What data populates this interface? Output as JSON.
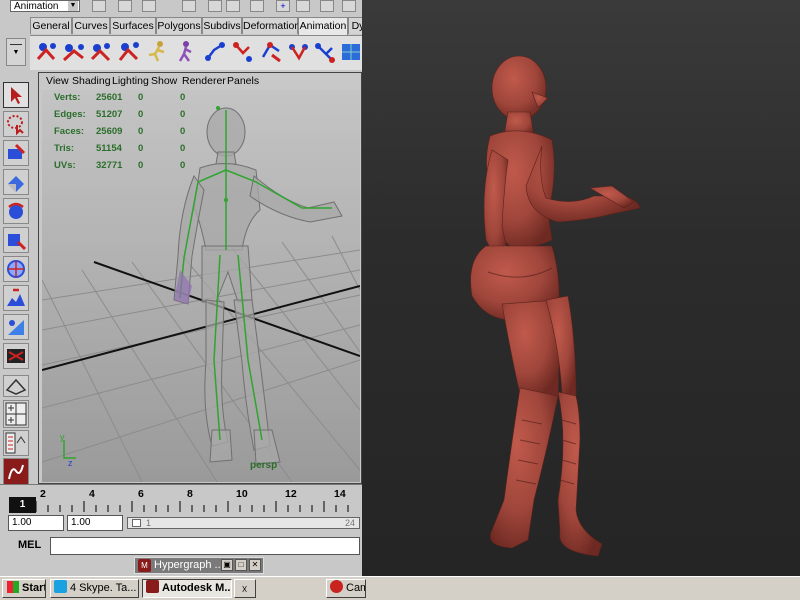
{
  "maya": {
    "mode_select": "Animation",
    "shelf_tabs": [
      "General",
      "Curves",
      "Surfaces",
      "Polygons",
      "Subdivs",
      "Deformation",
      "Animation",
      "Dy"
    ],
    "active_shelf_tab": "Animation",
    "viewport_menu": [
      "View",
      "Shading",
      "Lighting",
      "Show",
      "Renderer",
      "Panels"
    ],
    "stats": [
      {
        "label": "Verts:",
        "total": "25601",
        "selected": "0",
        "components": "0"
      },
      {
        "label": "Edges:",
        "total": "51207",
        "selected": "0",
        "components": "0"
      },
      {
        "label": "Faces:",
        "total": "25609",
        "selected": "0",
        "components": "0"
      },
      {
        "label": "Tris:",
        "total": "51154",
        "selected": "0",
        "components": "0"
      },
      {
        "label": "UVs:",
        "total": "32771",
        "selected": "0",
        "components": "0"
      }
    ],
    "camera_label": "persp",
    "timeline_ticks": [
      "2",
      "4",
      "6",
      "8",
      "10",
      "12",
      "14"
    ],
    "current_frame": "1",
    "range_start": "1.00",
    "range_current": "1.00",
    "range_slider_start": "1",
    "range_slider_end": "24",
    "mel_label": "MEL",
    "hypergraph_title": "Hypergraph ..."
  },
  "taskbar": {
    "start_label": "Start",
    "buttons": [
      {
        "label": "4 Skype. Ta...",
        "pressed": false
      },
      {
        "label": "Autodesk M...",
        "pressed": true
      },
      {
        "label": "",
        "pressed": false
      },
      {
        "label": "Cam",
        "pressed": false
      }
    ]
  },
  "colors": {
    "maya_panel": "#c8c8c8",
    "stats_text": "#2b6e2b",
    "zbrush_bg": "#2b2b2b",
    "sculpt_skin": "#a84a3e"
  },
  "icons": [
    "select-arrow-icon",
    "lasso-icon",
    "paint-icon",
    "move-icon",
    "rotate-icon",
    "scale-icon",
    "manipulator-icon",
    "show-manipulator-icon",
    "ik-handle-icon",
    "joint-icon",
    "skin-bind-icon"
  ]
}
